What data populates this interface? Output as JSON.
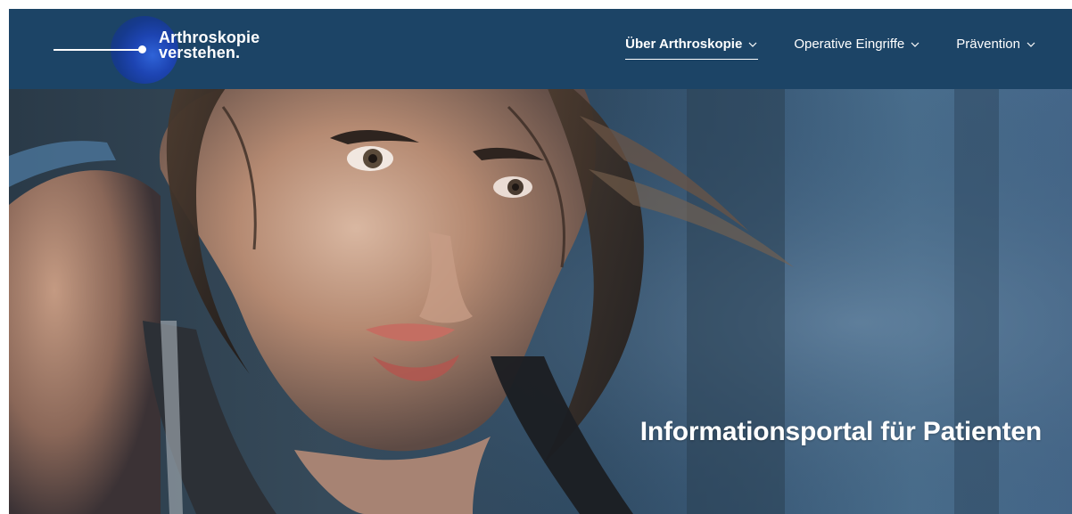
{
  "brand": {
    "line1": "Arthroskopie",
    "line2": "verstehen."
  },
  "nav": {
    "items": [
      {
        "label": "Über Arthroskopie",
        "active": true
      },
      {
        "label": "Operative Eingriffe",
        "active": false
      },
      {
        "label": "Prävention",
        "active": false
      }
    ]
  },
  "hero": {
    "title": "Informationsportal für Patienten"
  },
  "colors": {
    "header": "#1c4466",
    "logo_orb": "#1d44b2",
    "text": "#ffffff"
  },
  "icons": {
    "dropdown": "chevron-down-icon"
  }
}
